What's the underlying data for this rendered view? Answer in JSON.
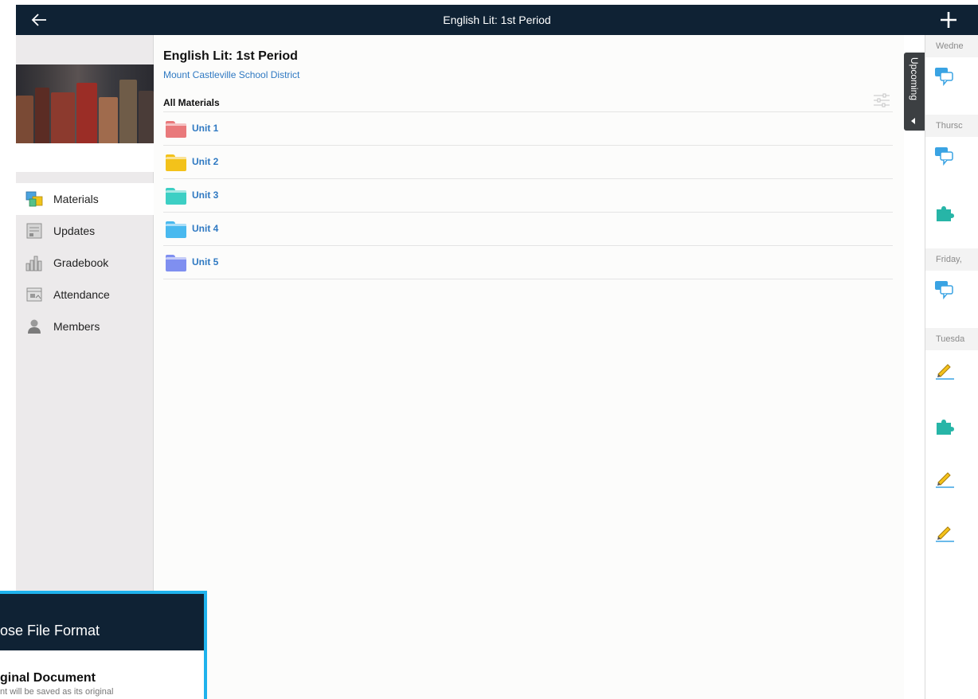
{
  "topbar": {
    "title": "English Lit: 1st Period",
    "back_icon": "arrow-left-icon",
    "add_icon": "plus-icon"
  },
  "course": {
    "title": "English Lit: 1st Period",
    "district": "Mount Castleville School District"
  },
  "sidebar": {
    "items": [
      {
        "label": "Materials",
        "icon": "materials-icon",
        "active": true
      },
      {
        "label": "Updates",
        "icon": "updates-icon"
      },
      {
        "label": "Gradebook",
        "icon": "gradebook-icon"
      },
      {
        "label": "Attendance",
        "icon": "attendance-icon"
      },
      {
        "label": "Members",
        "icon": "members-icon"
      }
    ]
  },
  "materials": {
    "section_title": "All Materials",
    "folders": [
      {
        "label": "Unit 1",
        "color": "#e9797b"
      },
      {
        "label": "Unit 2",
        "color": "#f3c21a"
      },
      {
        "label": "Unit 3",
        "color": "#3dcfc4"
      },
      {
        "label": "Unit 4",
        "color": "#49b9ef"
      },
      {
        "label": "Unit 5",
        "color": "#7f8ff0"
      }
    ]
  },
  "upcoming": {
    "tab_label": "Upcoming",
    "days": [
      {
        "label": "Wedne",
        "items": [
          "discussion-icon"
        ]
      },
      {
        "label": "Thursc",
        "items": [
          "discussion-icon",
          "puzzle-icon"
        ]
      },
      {
        "label": "Friday,",
        "items": [
          "discussion-icon"
        ]
      },
      {
        "label": "Tuesda",
        "items": [
          "pencil-icon",
          "puzzle-icon",
          "pencil-icon",
          "pencil-icon"
        ]
      }
    ]
  },
  "dialog": {
    "title": "ose File Format",
    "option_title": "ginal Document",
    "option_desc": "nt will be saved as its original"
  },
  "colors": {
    "header_bg": "#0f2234",
    "link": "#2f79c2",
    "dialog_border": "#1fb2ec",
    "sidebar_bg": "#eceaeb"
  }
}
